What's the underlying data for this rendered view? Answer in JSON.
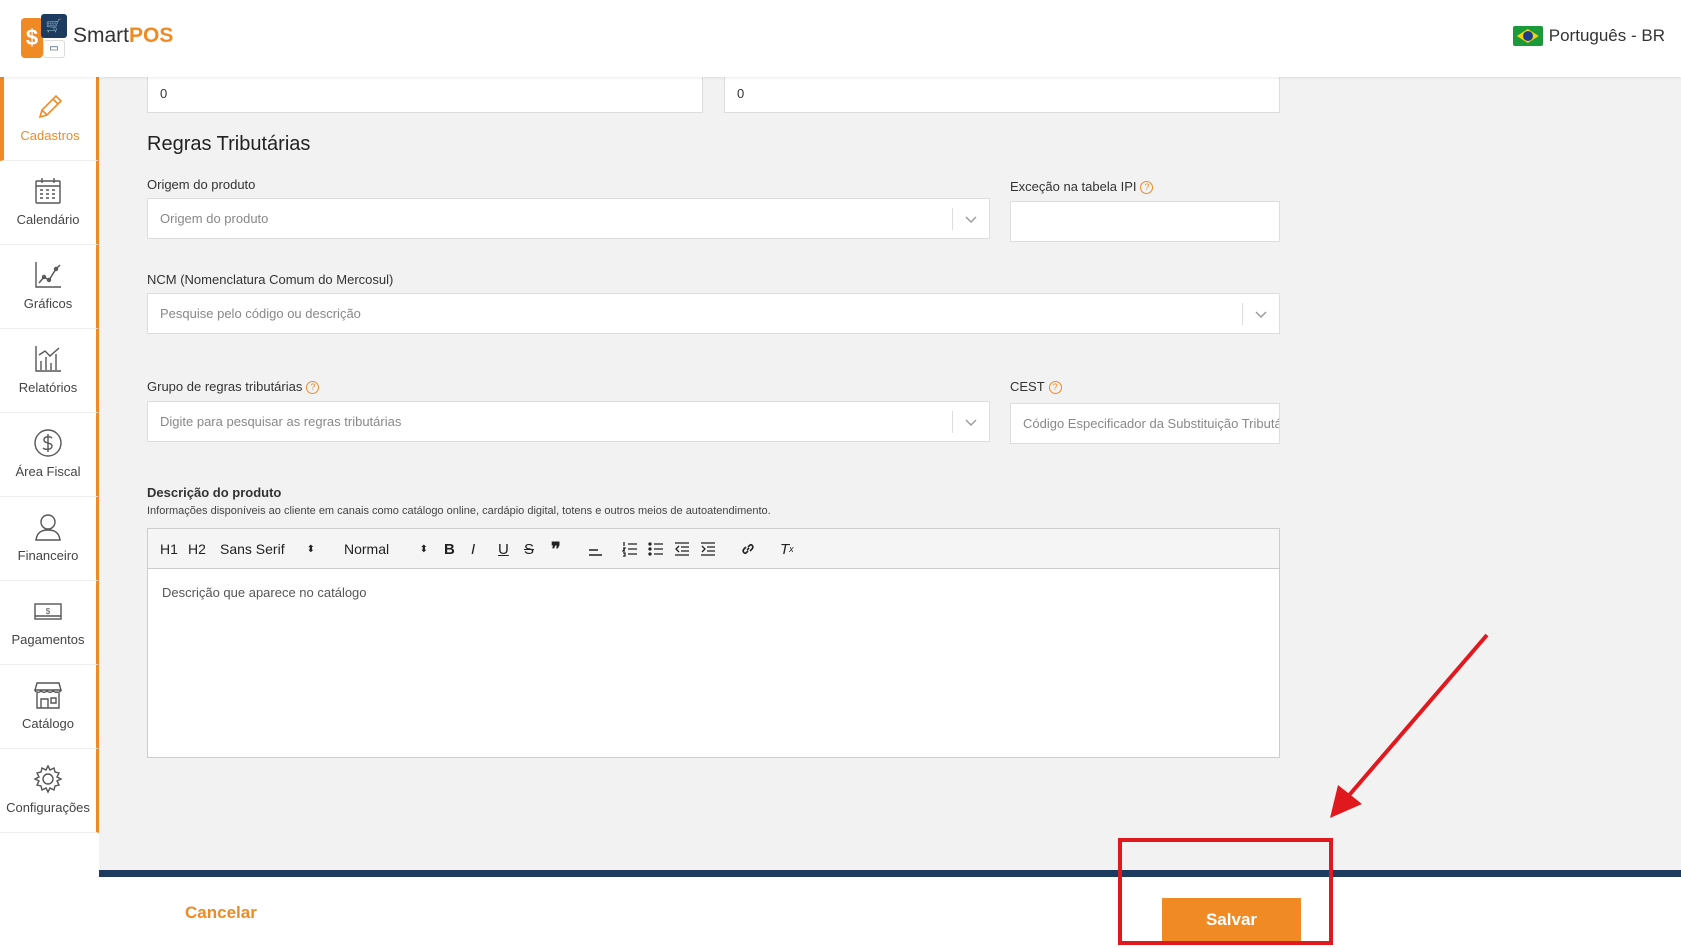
{
  "header": {
    "brand_prefix": "Smart",
    "brand_suffix": "POS",
    "language": "Português - BR"
  },
  "sidebar": {
    "items": [
      {
        "label": "Cadastros",
        "icon": "pencil-icon"
      },
      {
        "label": "Calendário",
        "icon": "calendar-icon"
      },
      {
        "label": "Gráficos",
        "icon": "line-chart-icon"
      },
      {
        "label": "Relatórios",
        "icon": "bar-chart-icon"
      },
      {
        "label": "Área Fiscal",
        "icon": "dollar-circle-icon"
      },
      {
        "label": "Financeiro",
        "icon": "person-icon"
      },
      {
        "label": "Pagamentos",
        "icon": "banknote-icon"
      },
      {
        "label": "Catálogo",
        "icon": "store-icon"
      },
      {
        "label": "Configurações",
        "icon": "gear-icon"
      }
    ]
  },
  "form": {
    "top_fields": {
      "left_value": "0",
      "right_value": "0"
    },
    "section_title": "Regras Tributárias",
    "origem": {
      "label": "Origem do produto",
      "placeholder": "Origem do produto"
    },
    "excecao_ipi": {
      "label": "Exceção na tabela IPI",
      "value": ""
    },
    "ncm": {
      "label": "NCM (Nomenclatura Comum do Mercosul)",
      "placeholder": "Pesquise pelo código ou descrição"
    },
    "grupo_regras": {
      "label": "Grupo de regras tributárias",
      "placeholder": "Digite para pesquisar as regras tributárias"
    },
    "cest": {
      "label": "CEST",
      "placeholder": "Código Especificador da Substituição Tributária"
    },
    "descricao": {
      "label": "Descrição do produto",
      "hint": "Informações disponíveis ao cliente em canais como catálogo online, cardápio digital, totens e outros meios de autoatendimento.",
      "placeholder": "Descrição que aparece no catálogo",
      "toolbar": {
        "h1": "H1",
        "h2": "H2",
        "font": "Sans Serif",
        "size": "Normal"
      }
    }
  },
  "footer": {
    "cancel_label": "Cancelar",
    "save_label": "Salvar"
  },
  "colors": {
    "accent": "#f08a24",
    "navy": "#1d3a5f",
    "annotation": "#e0191e"
  }
}
